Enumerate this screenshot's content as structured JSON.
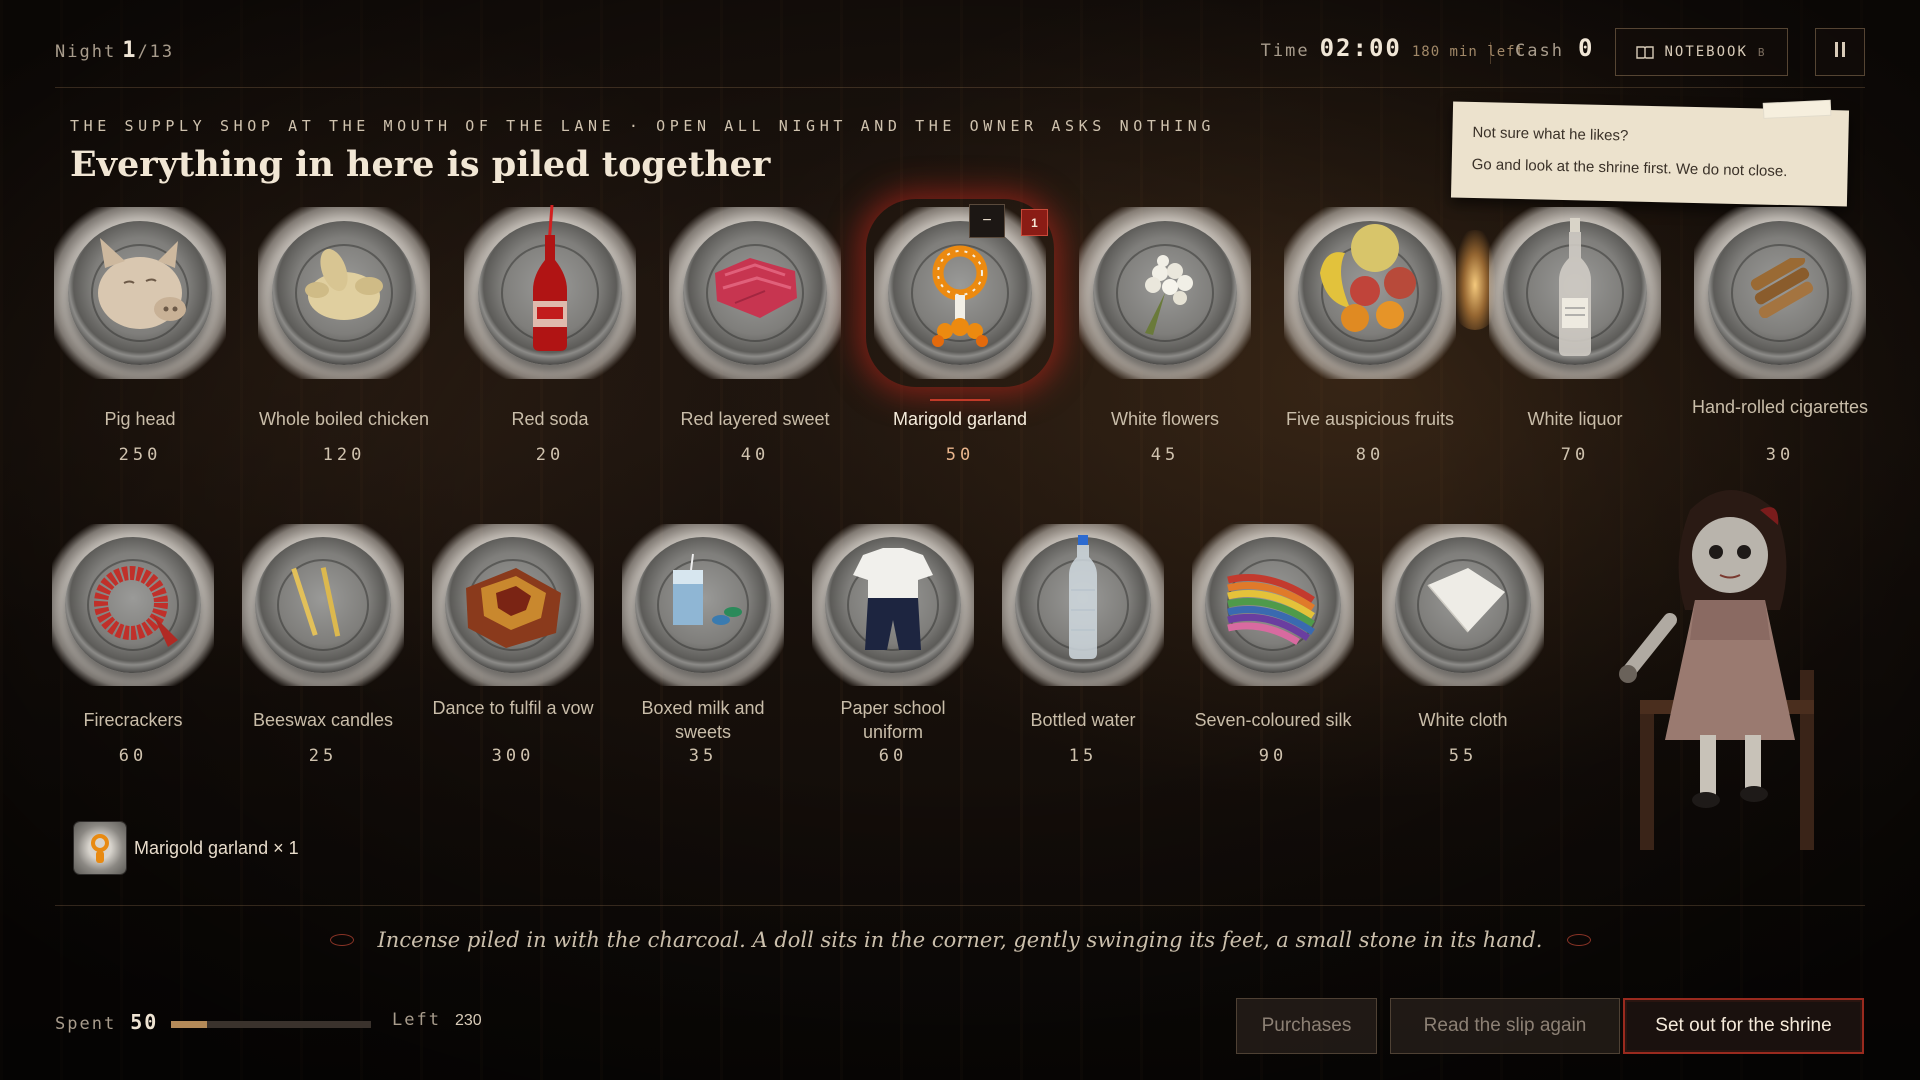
{
  "hud": {
    "night_label": "Night",
    "night_current": "1",
    "night_total": "/13",
    "time_label": "Time",
    "time_value": "02:00",
    "time_left": "180 min left",
    "cash_label": "Cash",
    "cash_value": "0",
    "notebook_label": "NOTEBOOK",
    "notebook_key": "B"
  },
  "shop": {
    "subtitle": "THE SUPPLY SHOP AT THE MOUTH OF THE LANE · OPEN ALL NIGHT AND THE OWNER ASKS NOTHING",
    "title": "Everything in here is piled together"
  },
  "note": {
    "line1": "Not sure what he likes?",
    "line2": "Go and look at the shrine first. We do not close."
  },
  "items_row1": [
    {
      "name": "Pig head",
      "price": "250"
    },
    {
      "name": "Whole boiled chicken",
      "price": "120"
    },
    {
      "name": "Red soda",
      "price": "20"
    },
    {
      "name": "Red layered sweet",
      "price": "40"
    },
    {
      "name": "Marigold garland",
      "price": "50",
      "selected": true,
      "qty": "1",
      "minus": "−"
    },
    {
      "name": "White flowers",
      "price": "45"
    },
    {
      "name": "Five auspicious fruits",
      "price": "80"
    },
    {
      "name": "White liquor",
      "price": "70"
    },
    {
      "name": "Hand-rolled cigarettes",
      "price": "30"
    }
  ],
  "items_row2": [
    {
      "name": "Firecrackers",
      "price": "60"
    },
    {
      "name": "Beeswax candles",
      "price": "25"
    },
    {
      "name": "Dance to fulfil a vow",
      "price": "300"
    },
    {
      "name": "Boxed milk and sweets",
      "price": "35"
    },
    {
      "name": "Paper school uniform",
      "price": "60"
    },
    {
      "name": "Bottled water",
      "price": "15"
    },
    {
      "name": "Seven-coloured silk",
      "price": "90"
    },
    {
      "name": "White cloth",
      "price": "55"
    }
  ],
  "cart": {
    "text": "Marigold garland × 1"
  },
  "narration": "Incense piled in with the charcoal. A doll sits in the corner, gently swinging its feet, a small stone in its hand.",
  "budget": {
    "spent_label": "Spent",
    "spent_value": "50",
    "left_label": "Left",
    "left_value": "230",
    "spent_fraction": 0.179
  },
  "buttons": {
    "purchases": "Purchases",
    "read_slip": "Read the slip again",
    "set_out": "Set out for the shrine"
  },
  "colors": {
    "accent_red": "#9a2a1e",
    "price_selected": "#e9b58c",
    "marigold": "#e88a12"
  },
  "icons": [
    "notebook-icon",
    "pause-icon",
    "eye-ornament-icon"
  ]
}
